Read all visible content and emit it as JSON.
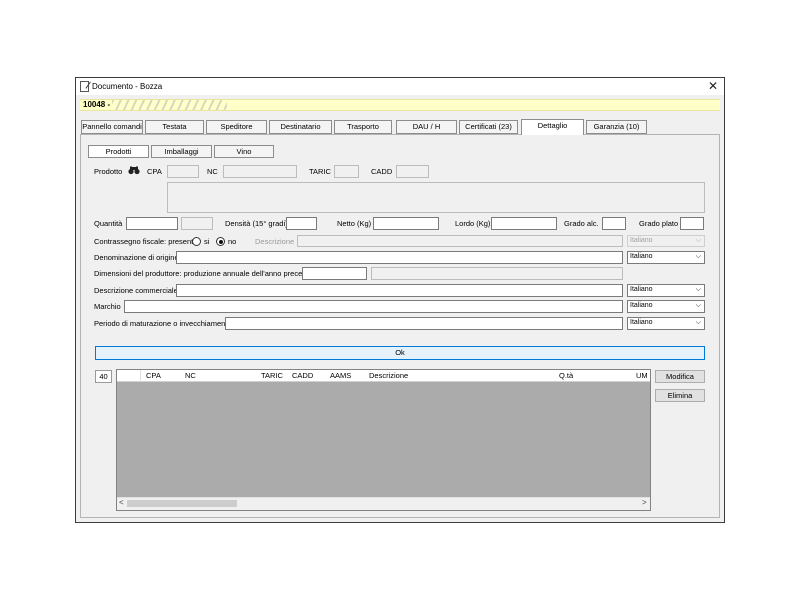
{
  "window": {
    "title": "Documento - Bozza",
    "close_glyph": "✕"
  },
  "doc_bar": {
    "number": "10048 -"
  },
  "tabs": [
    {
      "label": "Pannello comandi"
    },
    {
      "label": "Testata"
    },
    {
      "label": "Speditore"
    },
    {
      "label": "Destinatario"
    },
    {
      "label": "Trasporto"
    },
    {
      "label": "DAU / H"
    },
    {
      "label": "Certificati (23)"
    },
    {
      "label": "Dettaglio",
      "active": true
    },
    {
      "label": "Garanzia (10)"
    }
  ],
  "subtabs": [
    {
      "label": "Prodotti",
      "active": true
    },
    {
      "label": "Imballaggi"
    },
    {
      "label": "Vino"
    }
  ],
  "form": {
    "prodotto_label": "Prodotto",
    "search_icon": "binoculars-icon",
    "cpa_label": "CPA",
    "nc_label": "NC",
    "taric_label": "TARIC",
    "cadd_label": "CADD",
    "quantita_label": "Quantità",
    "densita_label": "Densità (15° gradi)",
    "netto_label": "Netto (Kg)",
    "lordo_label": "Lordo (Kg)",
    "grado_alc_label": "Grado alc.",
    "grado_plato_label": "Grado plato",
    "contrassegno_label": "Contrassegno fiscale: presente",
    "radio_si": "si",
    "radio_no": "no",
    "radio_selected": "no",
    "descrizione_label": "Descrizione",
    "denominazione_label": "Denominazione di origine",
    "dimensioni_label": "Dimensioni del produttore: produzione annuale dell'anno precedente",
    "descr_comm_label": "Descrizione commerciale",
    "marchio_label": "Marchio",
    "periodo_label": "Periodo di maturazione o invecchiamento",
    "lang_descrizione": "Italiano",
    "lang_denominazione": "Italiano",
    "lang_descr_comm": "Italiano",
    "lang_marchio": "Italiano",
    "lang_periodo": "Italiano",
    "ok_label": "Ok"
  },
  "grid": {
    "count": "40",
    "columns": [
      "CPA",
      "NC",
      "TARIC",
      "CADD",
      "AAMS",
      "Descrizione",
      "Q.tà",
      "UM"
    ],
    "scroll_left": "<",
    "scroll_right": ">"
  },
  "actions": {
    "modifica": "Modifica",
    "elimina": "Elimina"
  },
  "colors": {
    "accent": "#0078d7",
    "doc_bar": "#ffffc8",
    "grid_bg": "#ababab"
  }
}
